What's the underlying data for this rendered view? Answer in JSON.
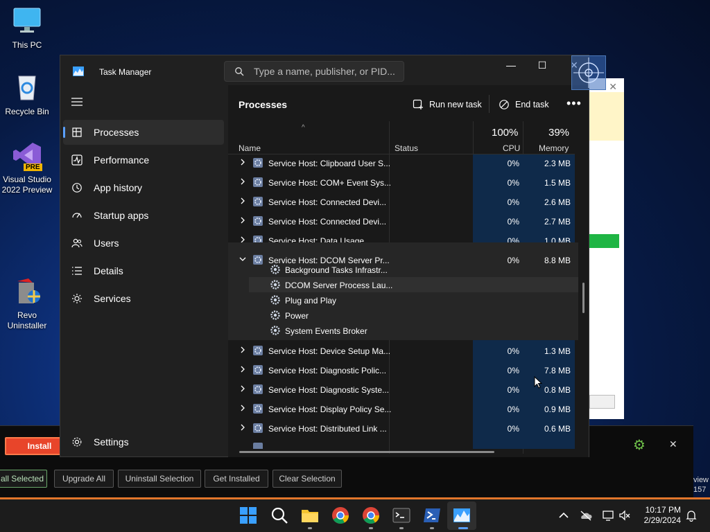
{
  "desktop": {
    "icons": [
      {
        "label": "This PC"
      },
      {
        "label": "Recycle Bin"
      },
      {
        "label": "Visual Studio 2022 Preview",
        "badge": "PRE"
      },
      {
        "label": "Revo Uninstaller"
      }
    ]
  },
  "task_manager": {
    "title": "Task Manager",
    "search_placeholder": "Type a name, publisher, or PID...",
    "window_controls": {
      "minimize": "—",
      "maximize": "☐",
      "close": "✕"
    },
    "nav": [
      {
        "label": "Processes",
        "icon": "grid-icon",
        "active": true
      },
      {
        "label": "Performance",
        "icon": "pulse-icon"
      },
      {
        "label": "App history",
        "icon": "history-icon"
      },
      {
        "label": "Startup apps",
        "icon": "speedometer-icon"
      },
      {
        "label": "Users",
        "icon": "users-icon"
      },
      {
        "label": "Details",
        "icon": "list-icon"
      },
      {
        "label": "Services",
        "icon": "puzzle-icon"
      }
    ],
    "settings_label": "Settings",
    "page_title": "Processes",
    "commands": {
      "run_new_task": "Run new task",
      "end_task": "End task",
      "more": "•••"
    },
    "columns": {
      "name": "Name",
      "status": "Status",
      "cpu_pct": "100%",
      "cpu": "CPU",
      "mem_pct": "39%",
      "mem": "Memory"
    },
    "rows_before": [
      {
        "name": "Service Host: Clipboard User S...",
        "cpu": "0%",
        "mem": "2.3 MB"
      },
      {
        "name": "Service Host: COM+ Event Sys...",
        "cpu": "0%",
        "mem": "1.5 MB"
      },
      {
        "name": "Service Host: Connected Devi...",
        "cpu": "0%",
        "mem": "2.6 MB"
      },
      {
        "name": "Service Host: Connected Devi...",
        "cpu": "0%",
        "mem": "2.7 MB"
      },
      {
        "name": "Service Host: Data Usage",
        "cpu": "0%",
        "mem": "1.0 MB"
      }
    ],
    "expanded": {
      "name": "Service Host: DCOM Server Pr...",
      "cpu": "0%",
      "mem": "8.8 MB",
      "children": [
        "Background Tasks Infrastr...",
        "DCOM Server Process Lau...",
        "Plug and Play",
        "Power",
        "System Events Broker"
      ]
    },
    "rows_after": [
      {
        "name": "Service Host: Device Setup Ma...",
        "cpu": "0%",
        "mem": "1.3 MB"
      },
      {
        "name": "Service Host: Diagnostic Polic...",
        "cpu": "0%",
        "mem": "7.8 MB"
      },
      {
        "name": "Service Host: Diagnostic Syste...",
        "cpu": "0%",
        "mem": "0.8 MB"
      },
      {
        "name": "Service Host: Display Policy Se...",
        "cpu": "0%",
        "mem": "0.9 MB"
      },
      {
        "name": "Service Host: Distributed Link ...",
        "cpu": "0%",
        "mem": "0.6 MB"
      }
    ]
  },
  "revo": {
    "install": "Install",
    "buttons": [
      "all Selected",
      "Upgrade All",
      "Uninstall Selection",
      "Get Installed",
      "Clear Selection"
    ],
    "side_text": [
      "view",
      "157"
    ],
    "close": "✕"
  },
  "taskbar": {
    "time": "10:17 PM",
    "date": "2/29/2024"
  },
  "colors": {
    "accent": "#5aa0ff",
    "cpu_column": "#0f2a4a",
    "revo_install": "#e8452a"
  }
}
